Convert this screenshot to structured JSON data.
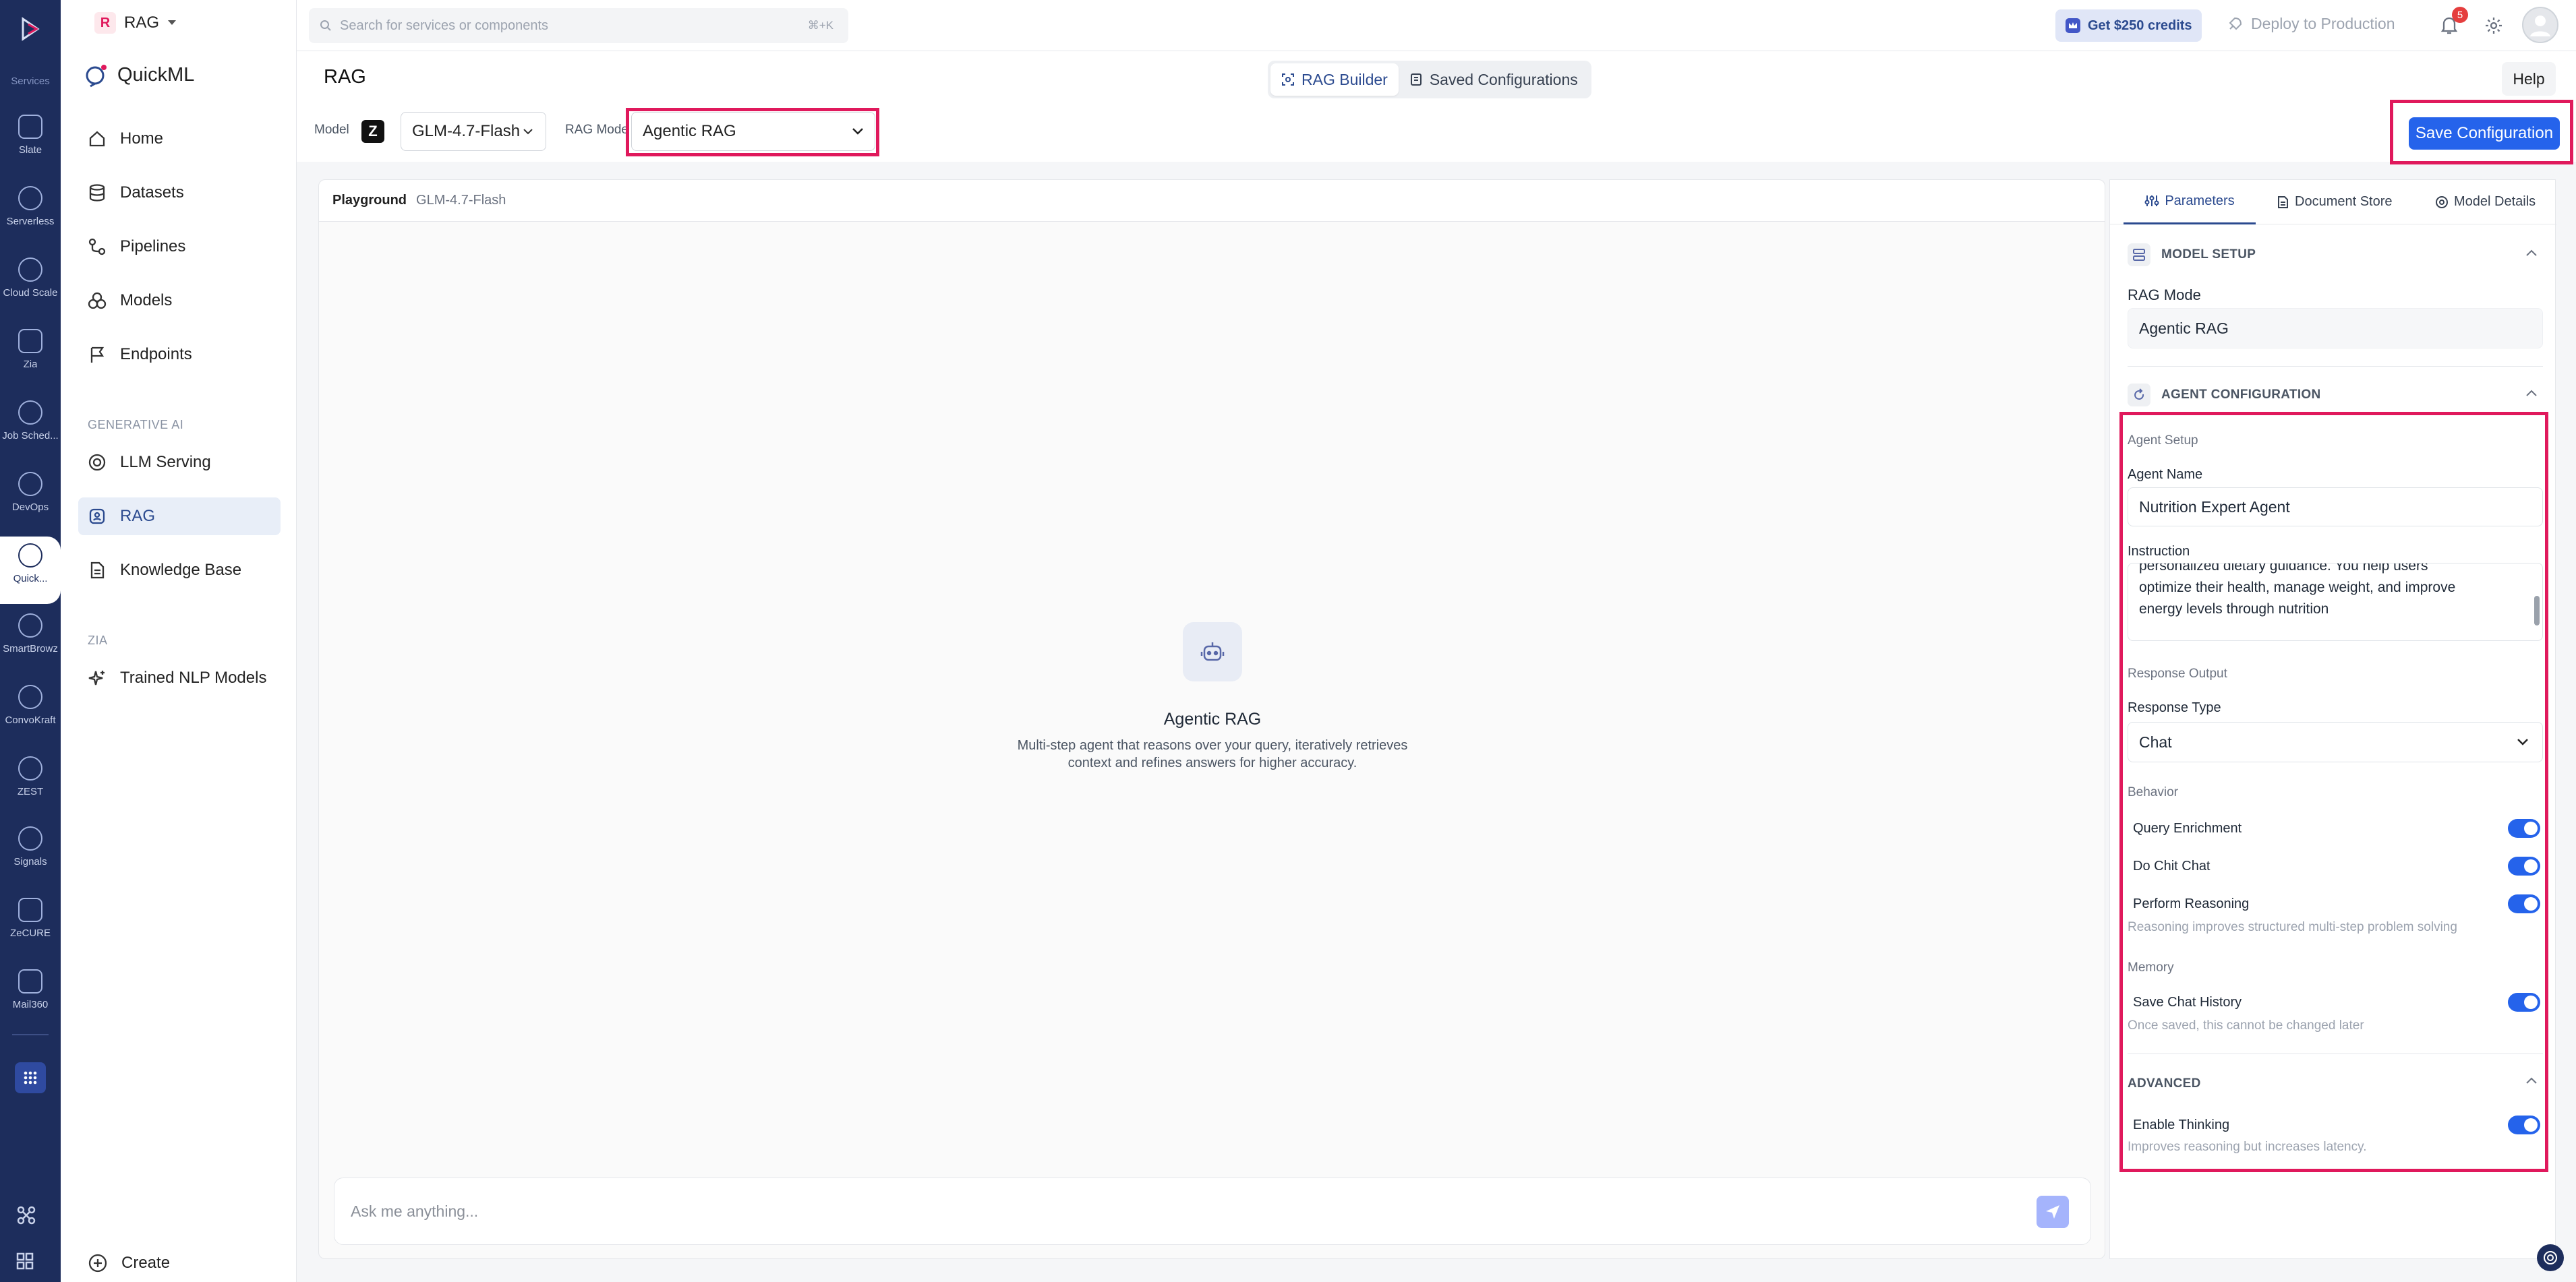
{
  "rail": {
    "services_label": "Services",
    "items": [
      {
        "label": "Slate",
        "icon": "slate-icon"
      },
      {
        "label": "Serverless",
        "icon": "serverless-icon"
      },
      {
        "label": "Cloud Scale",
        "icon": "cloud-scale-icon"
      },
      {
        "label": "Zia",
        "icon": "zia-icon"
      },
      {
        "label": "Job Sched...",
        "icon": "job-scheduler-icon"
      },
      {
        "label": "DevOps",
        "icon": "devops-icon"
      },
      {
        "label": "Quick...",
        "icon": "quickml-icon"
      },
      {
        "label": "SmartBrowz",
        "icon": "smartbrowz-icon"
      },
      {
        "label": "ConvoKraft",
        "icon": "convokraft-icon"
      },
      {
        "label": "ZEST",
        "icon": "zest-icon"
      },
      {
        "label": "Signals",
        "icon": "signals-icon"
      },
      {
        "label": "ZeCURE",
        "icon": "zecure-icon"
      },
      {
        "label": "Mail360",
        "icon": "mail360-icon"
      }
    ]
  },
  "project": {
    "badge": "R",
    "name": "RAG"
  },
  "search": {
    "placeholder": "Search for services or components",
    "shortcut": "⌘+K"
  },
  "topbar": {
    "credits": "Get $250 credits",
    "deploy": "Deploy to Production",
    "notif_count": "5"
  },
  "sidebar": {
    "app_name": "QuickML",
    "items": [
      {
        "label": "Home"
      },
      {
        "label": "Datasets"
      },
      {
        "label": "Pipelines"
      },
      {
        "label": "Models"
      },
      {
        "label": "Endpoints"
      }
    ],
    "section_genai": "GENERATIVE AI",
    "genai_items": [
      {
        "label": "LLM Serving"
      },
      {
        "label": "RAG"
      },
      {
        "label": "Knowledge Base"
      }
    ],
    "section_zia": "ZIA",
    "zia_items": [
      {
        "label": "Trained NLP Models"
      }
    ],
    "create": "Create"
  },
  "page": {
    "title": "RAG",
    "tabs": [
      {
        "label": "RAG Builder"
      },
      {
        "label": "Saved Configurations"
      }
    ],
    "help": "Help",
    "model_label": "Model",
    "model_value": "GLM-4.7-Flash",
    "rag_mode_label": "RAG Mode",
    "rag_mode_value": "Agentic RAG",
    "save_button": "Save Configuration"
  },
  "playground": {
    "label": "Playground",
    "model": "GLM-4.7-Flash",
    "empty_title": "Agentic RAG",
    "empty_desc_line1": "Multi-step agent that reasons over your query, iteratively retrieves",
    "empty_desc_line2": "context and refines answers for higher accuracy.",
    "input_placeholder": "Ask me anything..."
  },
  "panel": {
    "tabs": [
      {
        "label": "Parameters"
      },
      {
        "label": "Document Store"
      },
      {
        "label": "Model Details"
      }
    ],
    "model_setup": {
      "heading": "MODEL SETUP",
      "rag_mode_label": "RAG Mode",
      "rag_mode_value": "Agentic RAG"
    },
    "agent_config": {
      "heading": "AGENT CONFIGURATION",
      "agent_setup": "Agent Setup",
      "agent_name_label": "Agent Name",
      "agent_name_value": "Nutrition Expert Agent",
      "instruction_label": "Instruction",
      "instruction_line1": "personalized dietary guidance. You help users",
      "instruction_line2": "optimize their health, manage weight, and improve",
      "instruction_line3": "energy levels through nutrition",
      "response_output": "Response Output",
      "response_type_label": "Response Type",
      "response_type_value": "Chat",
      "behavior": "Behavior",
      "query_enrichment": "Query Enrichment",
      "do_chit_chat": "Do Chit Chat",
      "perform_reasoning": "Perform Reasoning",
      "reasoning_hint": "Reasoning improves structured multi-step problem solving",
      "memory": "Memory",
      "save_chat_history": "Save Chat History",
      "memory_hint": "Once saved, this cannot be changed later",
      "advanced": "ADVANCED",
      "enable_thinking": "Enable Thinking",
      "thinking_hint": "Improves reasoning but increases latency."
    }
  },
  "colors": {
    "primary": "#2563eb",
    "rail": "#1d2d5c",
    "highlight": "#e0195c"
  }
}
